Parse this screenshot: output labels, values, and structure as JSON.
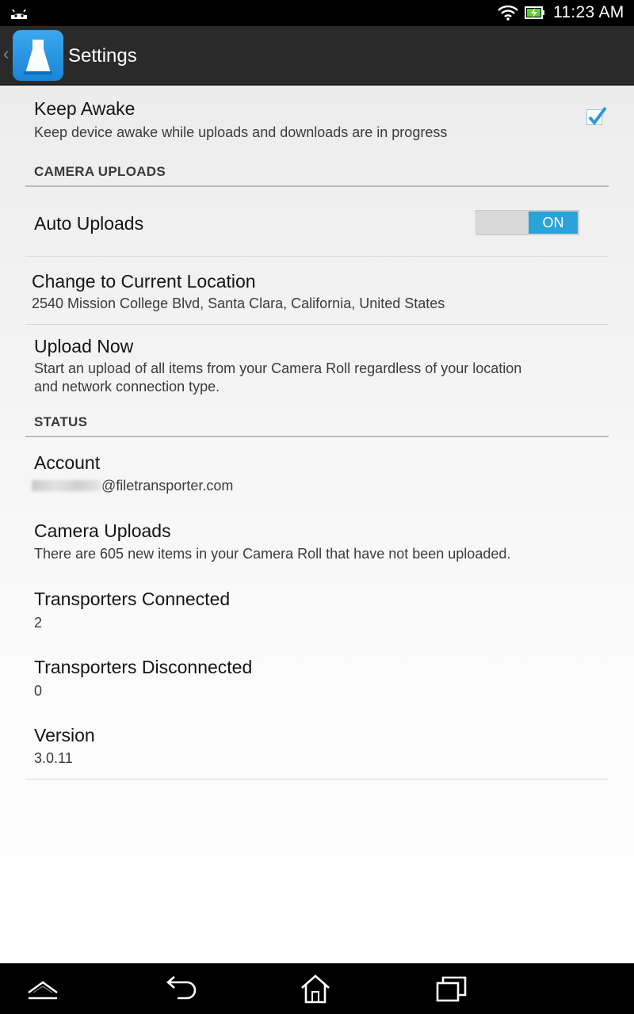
{
  "status_bar": {
    "time": "11:23 AM",
    "icons": [
      "android-icon",
      "wifi-icon",
      "battery-charging-icon"
    ]
  },
  "action_bar": {
    "title": "Settings",
    "icons": [
      "up-caret-icon",
      "app-icon"
    ]
  },
  "settings": {
    "keep_awake": {
      "title": "Keep Awake",
      "summary": "Keep device awake while uploads and downloads are in progress",
      "checked": true
    },
    "camera_uploads_category": "CAMERA UPLOADS",
    "auto_uploads": {
      "title": "Auto Uploads",
      "toggle_label": "ON",
      "state": "on"
    },
    "change_location": {
      "title": "Change to Current Location",
      "summary": "2540 Mission College Blvd, Santa Clara, California, United States"
    },
    "upload_now": {
      "title": "Upload Now",
      "summary_line1": "Start an upload of all items from your Camera Roll regardless of your location",
      "summary_line2": "and network connection type."
    },
    "status_category": "STATUS",
    "account": {
      "title": "Account",
      "email_domain": "@filetransporter.com"
    },
    "camera_uploads_status": {
      "title": "Camera Uploads",
      "summary": "There are 605 new items in your Camera Roll that have not been uploaded."
    },
    "transporters_connected": {
      "title": "Transporters Connected",
      "value": "2"
    },
    "transporters_disconnected": {
      "title": "Transporters Disconnected",
      "value": "0"
    },
    "version": {
      "title": "Version",
      "value": "3.0.11"
    }
  },
  "nav_bar": {
    "icons": [
      "menu-up-icon",
      "back-icon",
      "home-icon",
      "recent-apps-icon"
    ]
  },
  "colors": {
    "accent": "#29a3d8",
    "action_bar": "#2a2a2a",
    "status_bar": "#000000"
  }
}
